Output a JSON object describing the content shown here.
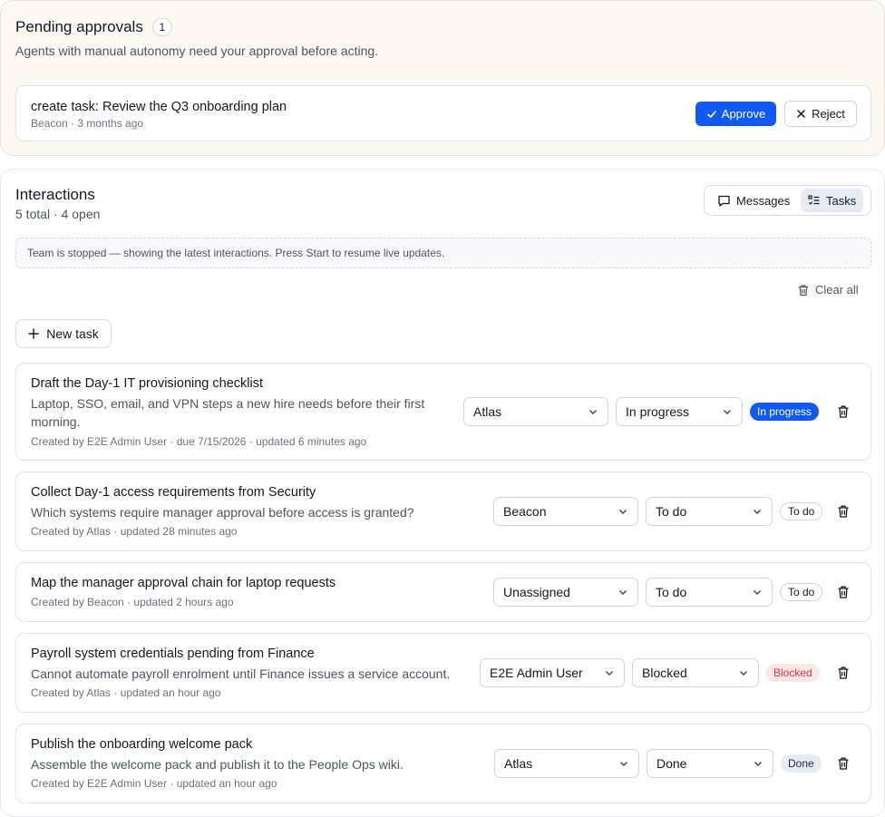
{
  "approvals": {
    "title": "Pending approvals",
    "count": "1",
    "subtitle": "Agents with manual autonomy need your approval before acting.",
    "item": {
      "name": "create task: Review the Q3 onboarding plan",
      "meta": "Beacon · 3 months ago",
      "approve_label": "Approve",
      "reject_label": "Reject"
    }
  },
  "interactions": {
    "title": "Interactions",
    "summary": "5 total · 4 open",
    "tabs": [
      {
        "label": "Messages",
        "icon": "message-icon",
        "active": false
      },
      {
        "label": "Tasks",
        "icon": "tasks-icon",
        "active": true
      }
    ],
    "notice": "Team is stopped — showing the latest interactions. Press Start to resume live updates.",
    "clear_all_label": "Clear all",
    "new_task_label": "New task"
  },
  "tasks": [
    {
      "title": "Draft the Day-1 IT provisioning checklist",
      "description_line1": "Laptop, SSO, email, and VPN steps a new hire needs before their first",
      "description_line2": "morning.",
      "meta": "Created by E2E Admin User · due 7/15/2026 · updated 6 minutes ago",
      "assignee": "Atlas",
      "status": "In progress",
      "badge": "In progress"
    },
    {
      "title": "Collect Day-1 access requirements from Security",
      "description": "Which systems require manager approval before access is granted?",
      "meta": "Created by Atlas · updated 28 minutes ago",
      "assignee": "Beacon",
      "status": "To do",
      "badge": "To do"
    },
    {
      "title": "Map the manager approval chain for laptop requests",
      "meta": "Created by Beacon · updated 2 hours ago",
      "assignee": "Unassigned",
      "status": "To do",
      "badge": "To do"
    },
    {
      "title": "Payroll system credentials pending from Finance",
      "description": "Cannot automate payroll enrolment until Finance issues a service account.",
      "meta": "Created by Atlas · updated an hour ago",
      "assignee": "E2E Admin User",
      "status": "Blocked",
      "badge": "Blocked"
    },
    {
      "title": "Publish the onboarding welcome pack",
      "description": "Assemble the welcome pack and publish it to the People Ops wiki.",
      "meta": "Created by E2E Admin User · updated an hour ago",
      "assignee": "Atlas",
      "status": "Done",
      "badge": "Done"
    }
  ],
  "colors": {
    "accent": "#1158f5",
    "blocked_text": "#d63a3a",
    "blocked_bg": "#fde6e6",
    "approvals_bg": "#fcf8f1"
  }
}
